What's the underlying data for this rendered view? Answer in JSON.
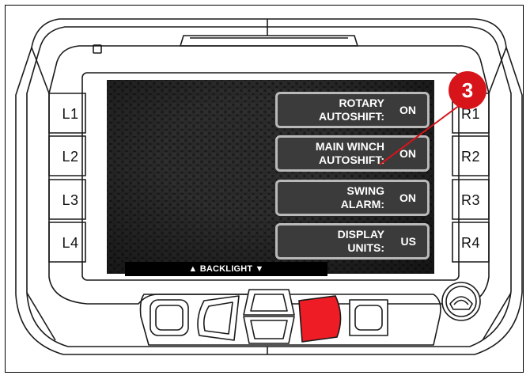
{
  "side_buttons": {
    "left": [
      "L1",
      "L2",
      "L3",
      "L4"
    ],
    "right": [
      "R1",
      "R2",
      "R3",
      "R4"
    ]
  },
  "menu": [
    {
      "line1": "ROTARY",
      "line2": "AUTOSHIFT:",
      "value": "ON"
    },
    {
      "line1": "MAIN WINCH",
      "line2": "AUTOSHIFT:",
      "value": "ON"
    },
    {
      "line1": "SWING",
      "line2": "ALARM:",
      "value": "ON"
    },
    {
      "line1": "DISPLAY",
      "line2": "UNITS:",
      "value": "US"
    }
  ],
  "backlight_label": "▲ BACKLIGHT ▼",
  "callout_number": "3",
  "colors": {
    "callout": "#d8141b",
    "highlighted_button": "#ee1c24",
    "menu_button_bg": "#3b3b3b",
    "menu_button_border": "#b9b9b9"
  }
}
